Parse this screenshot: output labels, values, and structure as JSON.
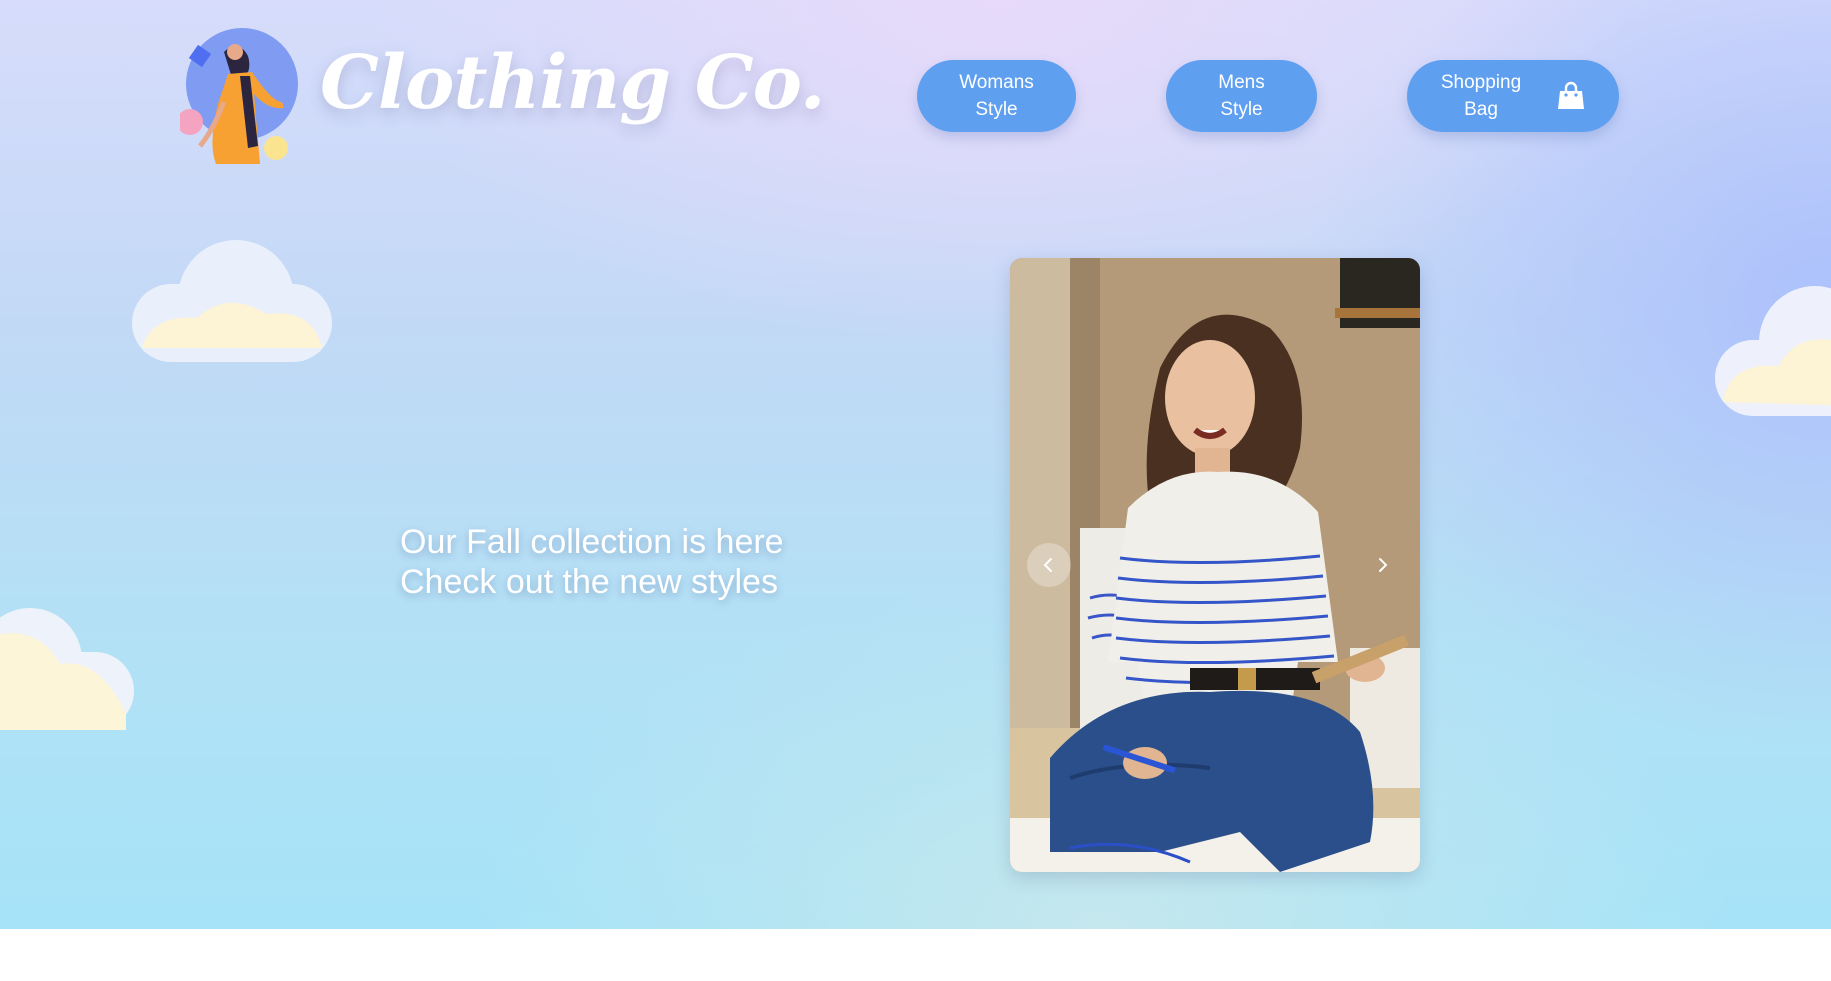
{
  "brand": {
    "name": "Clothing Co."
  },
  "nav": {
    "womens": {
      "line1": "Womans",
      "line2": "Style"
    },
    "mens": {
      "line1": "Mens",
      "line2": "Style"
    },
    "bag": {
      "line1": "Shopping",
      "line2": "Bag"
    }
  },
  "hero": {
    "line1": "Our Fall collection is here",
    "line2": "Check out the new styles"
  },
  "carousel": {
    "prev_icon": "chevron-left-icon",
    "next_icon": "chevron-right-icon"
  },
  "colors": {
    "nav_pill": "#5f9ff0",
    "logo_circle": "#7f9cf2",
    "logo_figure": "#f7a133"
  }
}
